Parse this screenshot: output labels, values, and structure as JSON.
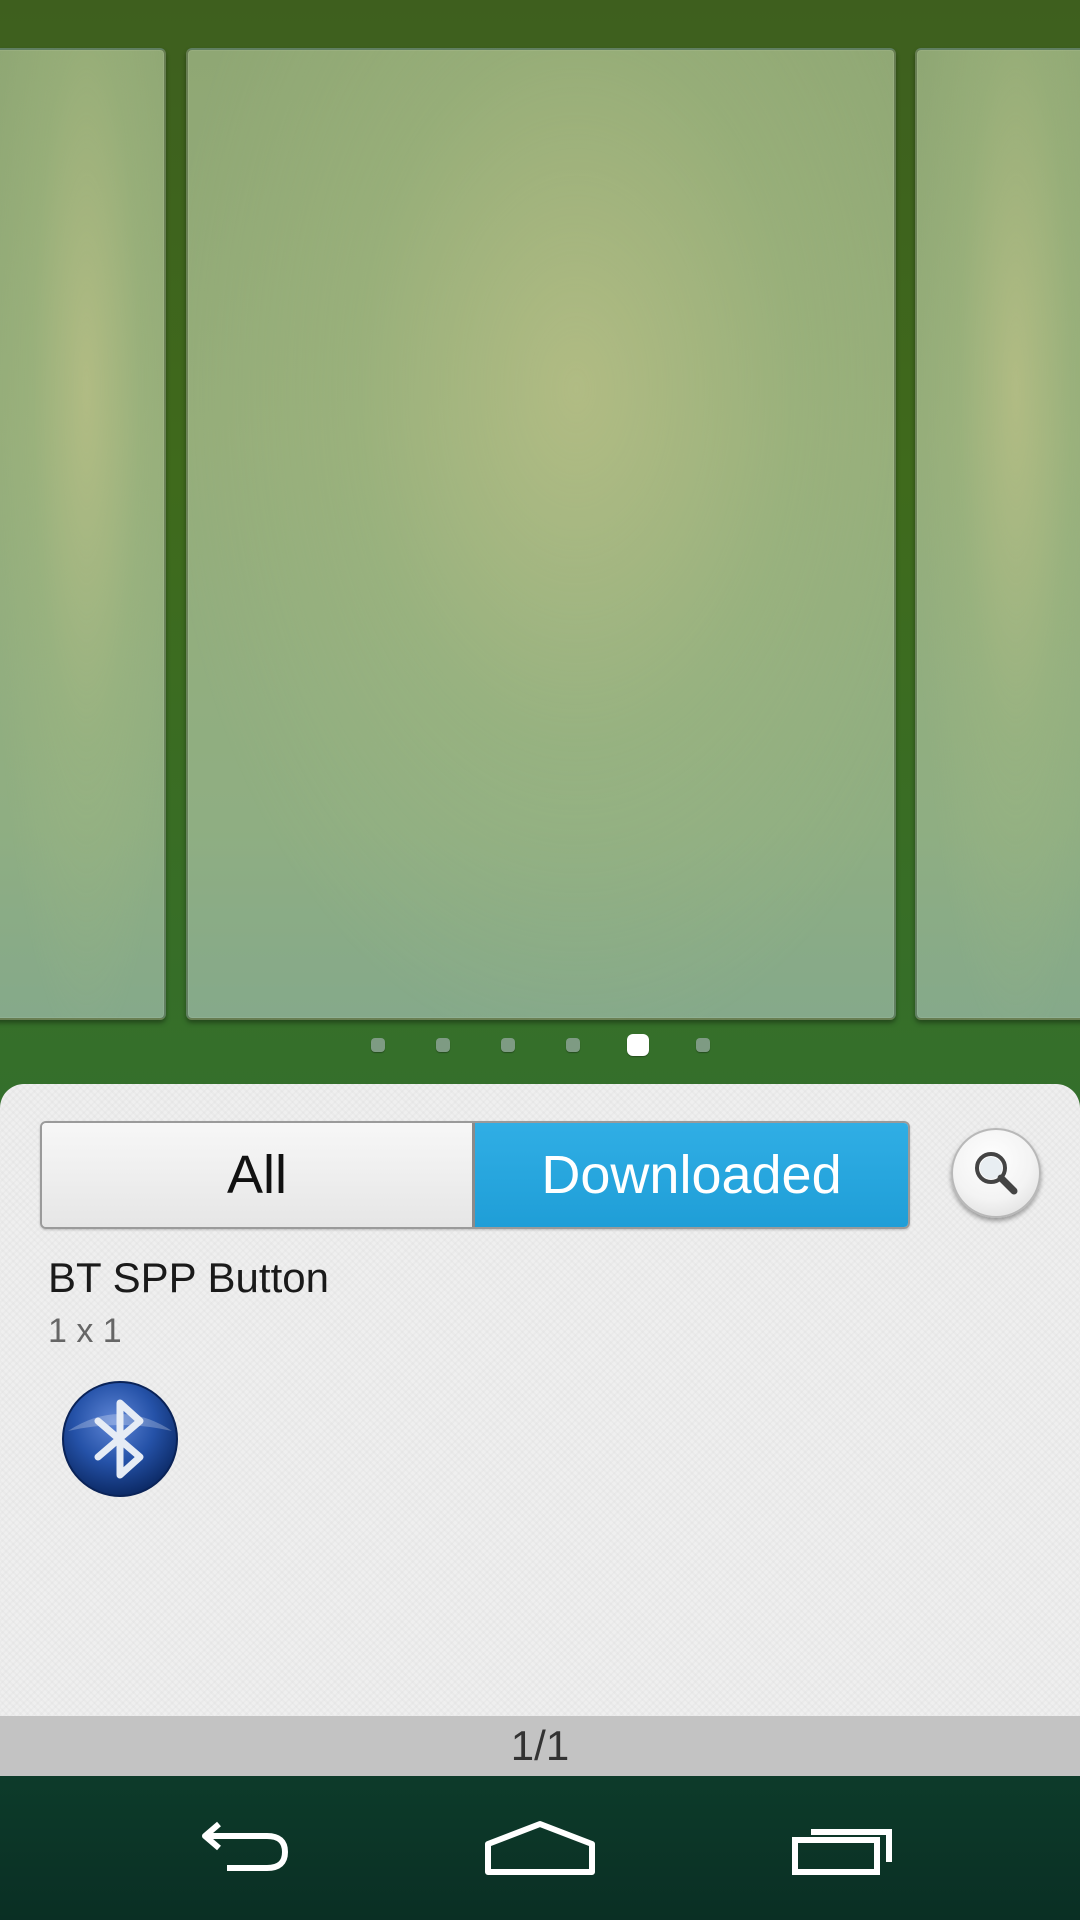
{
  "home_previews": {
    "count": 6,
    "active_index": 4
  },
  "widget_picker": {
    "tabs": [
      {
        "label": "All",
        "selected": false
      },
      {
        "label": "Downloaded",
        "selected": true
      }
    ],
    "search_icon": "search-icon",
    "items": [
      {
        "title": "BT SPP Button",
        "size": "1 x 1",
        "icon": "bluetooth-icon"
      }
    ],
    "page_indicator": "1/1"
  },
  "navigation": {
    "back_icon": "back-icon",
    "home_icon": "home-icon",
    "recent_icon": "recent-apps-icon"
  },
  "colors": {
    "accent": "#1f9ed7",
    "wallpaper": "#3f6a1c",
    "navbar": "#0a2f24"
  }
}
